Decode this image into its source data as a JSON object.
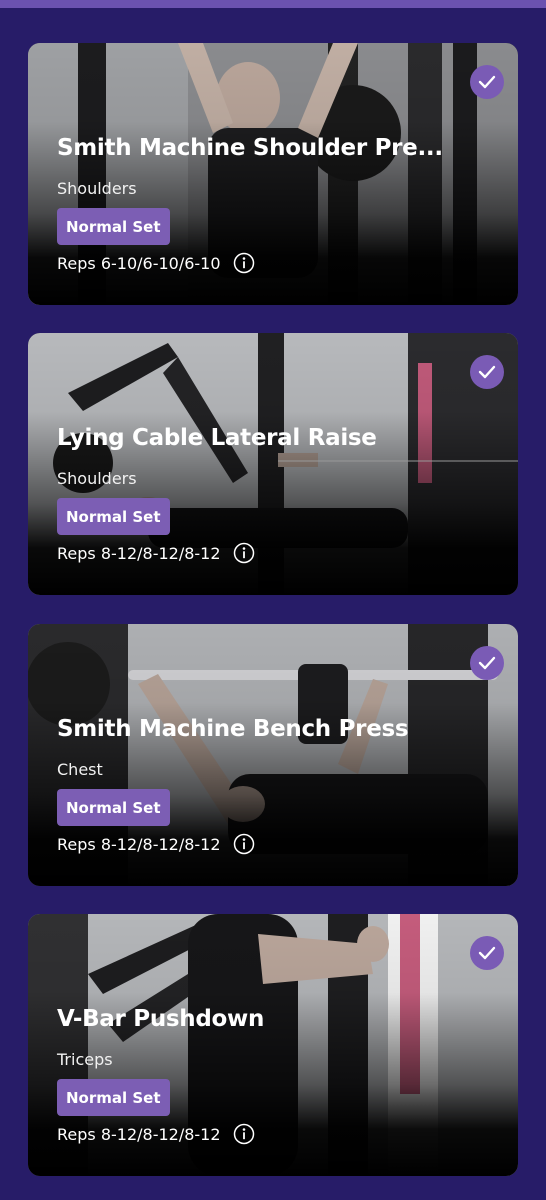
{
  "colors": {
    "background": "#271c68",
    "accent": "#7c5eb4"
  },
  "exercises": [
    {
      "title": "Smith Machine Shoulder Pre...",
      "muscle": "Shoulders",
      "set_type": "Normal Set",
      "reps": "Reps 6-10/6-10/6-10",
      "completed": true,
      "icon": "check-icon"
    },
    {
      "title": "Lying Cable Lateral Raise",
      "muscle": "Shoulders",
      "set_type": "Normal Set",
      "reps": "Reps 8-12/8-12/8-12",
      "completed": true,
      "icon": "check-icon"
    },
    {
      "title": "Smith Machine Bench Press",
      "muscle": "Chest",
      "set_type": "Normal Set",
      "reps": "Reps 8-12/8-12/8-12",
      "completed": true,
      "icon": "check-icon"
    },
    {
      "title": "V-Bar Pushdown",
      "muscle": "Triceps",
      "set_type": "Normal Set",
      "reps": "Reps 8-12/8-12/8-12",
      "completed": true,
      "icon": "check-icon"
    }
  ]
}
